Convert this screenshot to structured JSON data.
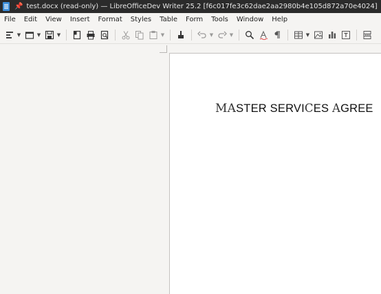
{
  "window": {
    "title": "test.docx (read-only) — LibreOfficeDev Writer 25.2 [f6c017fe3c62dae2aa2980b4e105d872a70e4024]"
  },
  "menubar": {
    "items": [
      "File",
      "Edit",
      "View",
      "Insert",
      "Format",
      "Styles",
      "Table",
      "Form",
      "Tools",
      "Window",
      "Help"
    ]
  },
  "toolbar": {
    "buttons": [
      {
        "name": "new-document",
        "icon": "new-document-icon",
        "dropdown": true
      },
      {
        "name": "open",
        "icon": "folder-icon",
        "dropdown": true
      },
      {
        "name": "save",
        "icon": "save-icon",
        "dropdown": true
      },
      {
        "name": "export-pdf",
        "icon": "pdf-export-icon"
      },
      {
        "name": "print",
        "icon": "printer-icon"
      },
      {
        "name": "print-preview",
        "icon": "print-preview-icon"
      },
      {
        "name": "cut",
        "icon": "scissors-icon",
        "disabled": true
      },
      {
        "name": "copy",
        "icon": "copy-icon",
        "disabled": true
      },
      {
        "name": "paste",
        "icon": "clipboard-icon",
        "disabled": true,
        "dropdown": true
      },
      {
        "name": "clone-formatting",
        "icon": "paintbrush-icon"
      },
      {
        "name": "undo",
        "icon": "undo-icon",
        "disabled": true,
        "dropdown": true
      },
      {
        "name": "redo",
        "icon": "redo-icon",
        "disabled": true,
        "dropdown": true
      },
      {
        "name": "find-replace",
        "icon": "magnifier-icon"
      },
      {
        "name": "spelling",
        "icon": "spellcheck-icon"
      },
      {
        "name": "formatting-marks",
        "icon": "pilcrow-icon"
      },
      {
        "name": "insert-table",
        "icon": "table-icon",
        "dropdown": true
      },
      {
        "name": "insert-image",
        "icon": "image-icon"
      },
      {
        "name": "insert-chart",
        "icon": "chart-icon"
      },
      {
        "name": "insert-textbox",
        "icon": "textbox-icon"
      },
      {
        "name": "insert-page-break",
        "icon": "page-break-icon"
      }
    ]
  },
  "document": {
    "title_parts": [
      {
        "text": "M",
        "small_caps": false,
        "serif": true
      },
      {
        "text": "A",
        "small_caps": false,
        "serif": true
      },
      {
        "text": "STER SERVI",
        "serif": false
      },
      {
        "text": "C",
        "serif": true
      },
      {
        "text": "ES ",
        "serif": false
      },
      {
        "text": "A",
        "serif": true
      },
      {
        "text": "GREE",
        "serif": false
      }
    ]
  },
  "colors": {
    "titlebar_bg": "#2b2b2b",
    "workspace_bg": "#f5f4f2",
    "page_bg": "#ffffff"
  }
}
